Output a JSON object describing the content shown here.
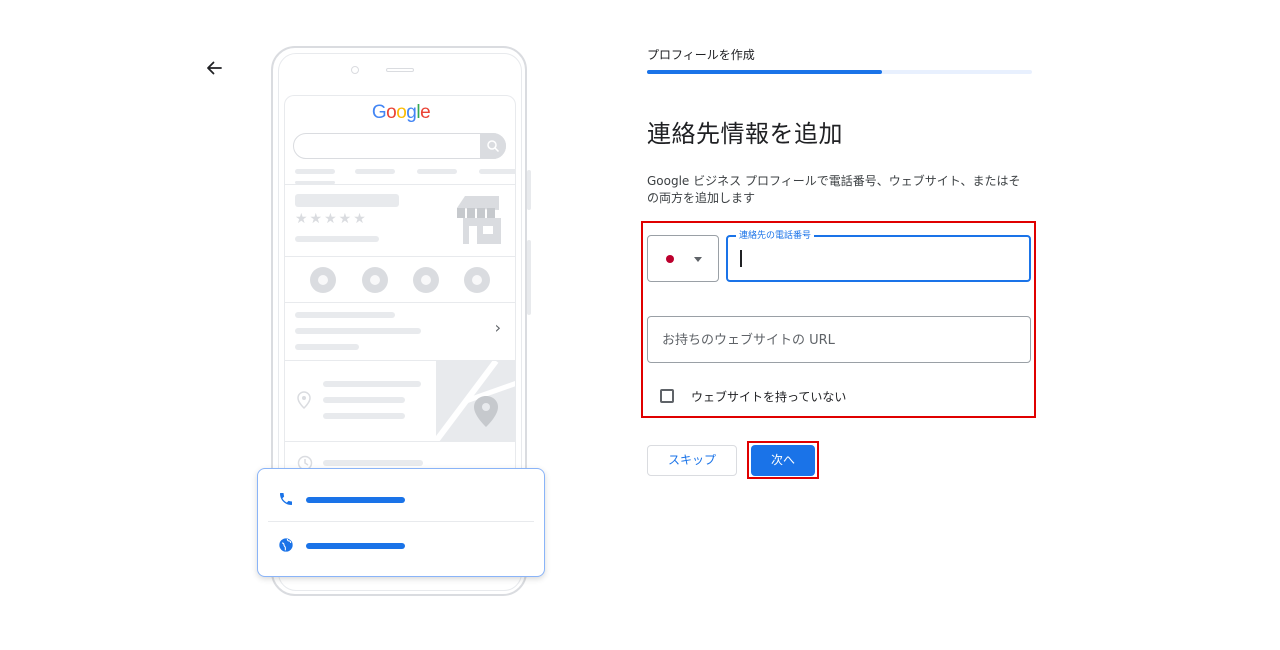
{
  "header": {
    "step_label": "プロフィールを作成",
    "progress_fraction": 0.61
  },
  "illustration": {
    "logo_text": "Google"
  },
  "form": {
    "title": "連絡先情報を追加",
    "description": "Google ビジネス プロフィールで電話番号、ウェブサイト、またはその両方を追加します",
    "country_flag_color": "#bc002d",
    "phone_label": "連絡先の電話番号",
    "phone_value": "",
    "url_placeholder": "お持ちのウェブサイトの URL",
    "url_value": "",
    "no_website_label": "ウェブサイトを持っていない",
    "no_website_checked": false
  },
  "buttons": {
    "skip": "スキップ",
    "next": "次へ"
  },
  "colors": {
    "accent": "#1a73e8",
    "highlight": "#e00000",
    "illustration_gray": "#dadce0"
  }
}
